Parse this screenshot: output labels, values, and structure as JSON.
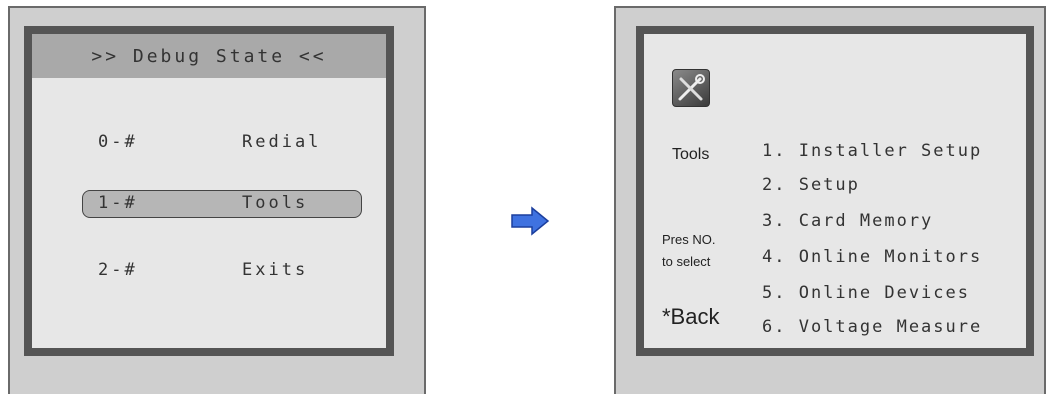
{
  "left_screen": {
    "title": ">> Debug State <<",
    "items": [
      {
        "code": "0-#",
        "label": "Redial",
        "selected": false
      },
      {
        "code": "1-#",
        "label": "Tools",
        "selected": true
      },
      {
        "code": "2-#",
        "label": "Exits",
        "selected": false
      }
    ]
  },
  "right_screen": {
    "icon_label": "Tools",
    "prompt_line1": "Pres NO.",
    "prompt_line2": "to select",
    "back_label": "*Back",
    "options": [
      "1. Installer Setup",
      "2. Setup",
      "3. Card Memory",
      "4. Online Monitors",
      "5. Online Devices",
      "6. Voltage Measure"
    ]
  },
  "colors": {
    "arrow_fill": "#3f72e0",
    "screen_bg": "#e7e7e7",
    "frame": "#555555"
  },
  "icons": {
    "arrow": "right-arrow-icon",
    "tools": "tools-icon"
  }
}
